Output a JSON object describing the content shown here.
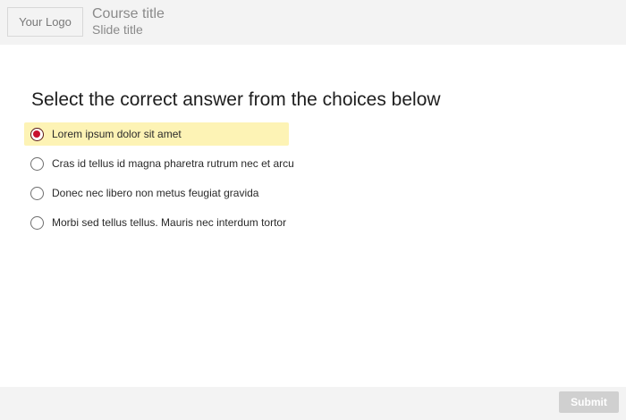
{
  "header": {
    "logo_text": "Your Logo",
    "course_title": "Course title",
    "slide_title": "Slide title"
  },
  "question": {
    "prompt": "Select the correct answer from the choices below",
    "choices": [
      {
        "label": "Lorem ipsum dolor sit amet",
        "selected": true
      },
      {
        "label": "Cras id tellus id magna pharetra rutrum nec et arcu",
        "selected": false
      },
      {
        "label": "Donec nec libero non metus feugiat gravida",
        "selected": false
      },
      {
        "label": "Morbi sed tellus tellus. Mauris nec interdum tortor",
        "selected": false
      }
    ]
  },
  "footer": {
    "submit_label": "Submit"
  },
  "colors": {
    "selected_highlight": "#fdf3b5",
    "radio_selected_dot": "#c8102e",
    "submit_disabled": "#d0d0d0",
    "header_bg": "#f3f3f3"
  }
}
